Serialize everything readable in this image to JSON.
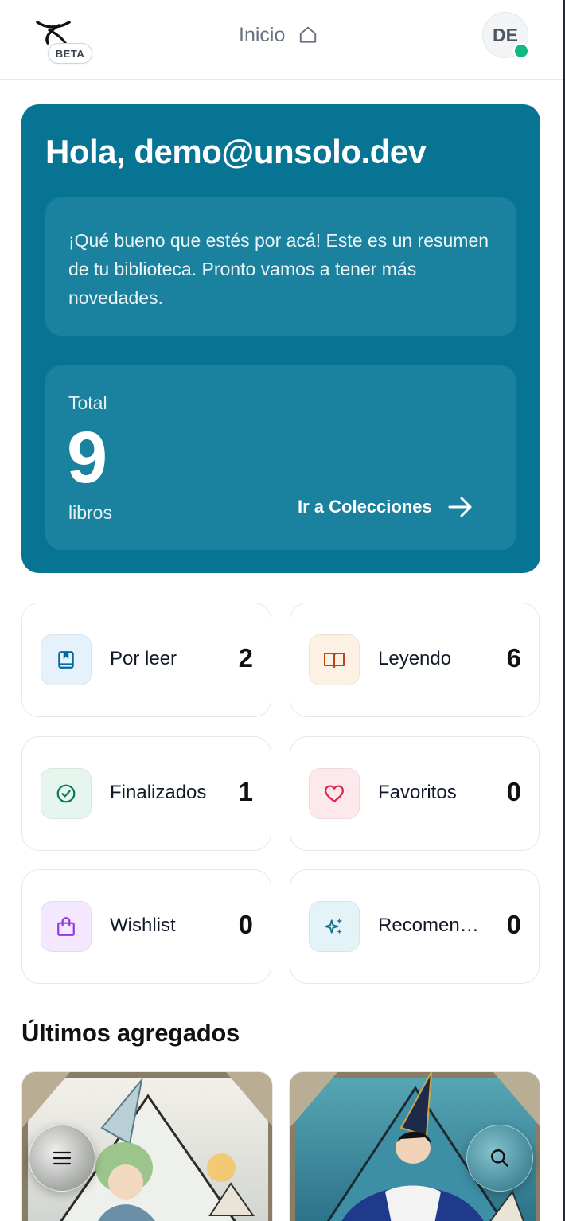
{
  "header": {
    "badge": "BETA",
    "nav_title": "Inicio",
    "avatar_initials": "DE"
  },
  "hero": {
    "greeting": "Hola, demo@unsolo.dev",
    "intro": "¡Qué bueno que estés por acá! Este es un resumen de tu biblioteca. Pronto vamos a tener más novedades.",
    "total_label": "Total",
    "total_value": "9",
    "total_unit": "libros",
    "collections_link": "Ir a Colecciones"
  },
  "stats": [
    {
      "label": "Por leer",
      "count": "2",
      "icon": "bookmark-icon",
      "color": "#0369a1",
      "bg": "#e6f2fb"
    },
    {
      "label": "Leyendo",
      "count": "6",
      "icon": "open-book-icon",
      "color": "#c2410c",
      "bg": "#fdf1e3"
    },
    {
      "label": "Finalizados",
      "count": "1",
      "icon": "check-circle-icon",
      "color": "#047857",
      "bg": "#e6f6ef"
    },
    {
      "label": "Favoritos",
      "count": "0",
      "icon": "heart-icon",
      "color": "#e11d48",
      "bg": "#fde8ec"
    },
    {
      "label": "Wishlist",
      "count": "0",
      "icon": "shopping-bag-icon",
      "color": "#9333ea",
      "bg": "#f3e8fd"
    },
    {
      "label": "Recomendados",
      "count": "0",
      "icon": "sparkles-icon",
      "color": "#0e7490",
      "bg": "#e4f3f8"
    }
  ],
  "recent": {
    "title": "Últimos agregados"
  },
  "colors": {
    "hero_bg": "#077494",
    "hero_inner": "#1a819e",
    "online": "#10b981"
  }
}
